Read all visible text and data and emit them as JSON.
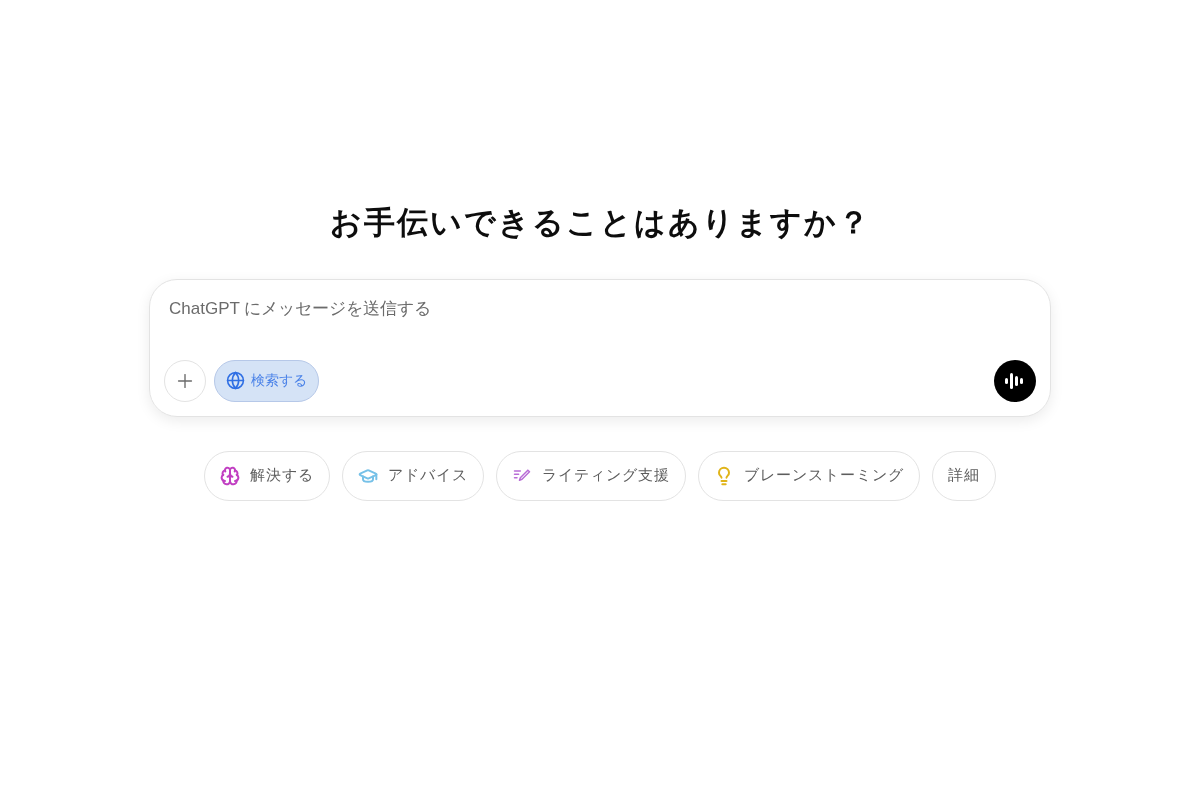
{
  "heading": "お手伝いできることはありますか？",
  "composer": {
    "placeholder": "ChatGPT にメッセージを送信する",
    "search_toggle": {
      "label": "検索する",
      "selected": true
    }
  },
  "suggestions": [
    {
      "kind": "brain",
      "label": "解決する",
      "color": "#c13fc2"
    },
    {
      "kind": "cap",
      "label": "アドバイス",
      "color": "#76c1e8"
    },
    {
      "kind": "pen",
      "label": "ライティング支援",
      "color": "#b86cd6"
    },
    {
      "kind": "bulb",
      "label": "ブレーンストーミング",
      "color": "#e0b419"
    },
    {
      "kind": "more",
      "label": "詳細"
    }
  ]
}
